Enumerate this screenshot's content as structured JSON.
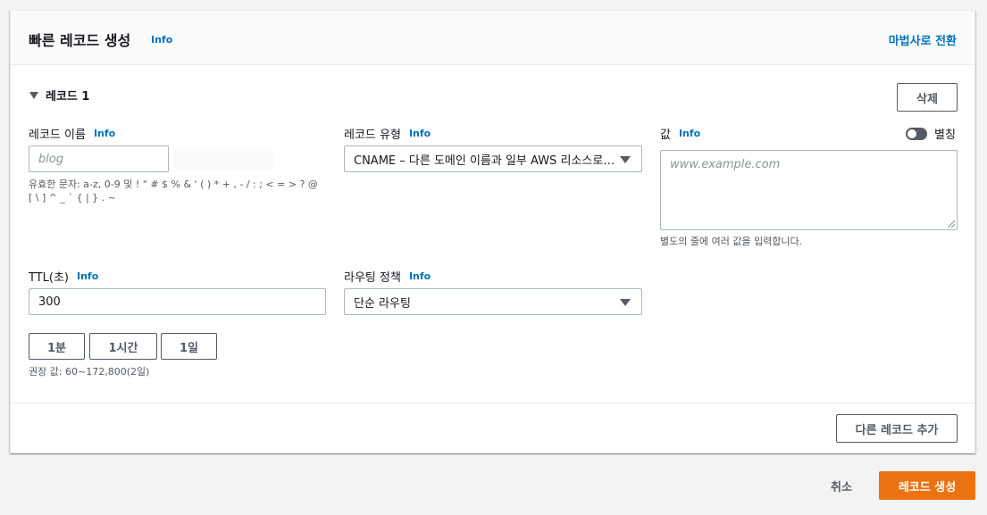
{
  "header": {
    "title": "빠른 레코드 생성",
    "info": "Info",
    "wizard_link": "마법사로 전환"
  },
  "record": {
    "title": "레코드 1",
    "delete_label": "삭제",
    "name": {
      "label": "레코드 이름",
      "info": "Info",
      "placeholder": "blog",
      "hint": "유효한 문자: a-z, 0-9 및 ! \" # $ % & ' ( ) * + , - / : ; < = > ? @ [ \\ ] ^ _ ` { | } . ~"
    },
    "type": {
      "label": "레코드 유형",
      "info": "Info",
      "value": "CNAME – 다른 도메인 이름과 일부 AWS 리소스로…"
    },
    "value": {
      "label": "값",
      "info": "Info",
      "alias_label": "별칭",
      "alias_enabled": false,
      "placeholder": "www.example.com",
      "hint": "별도의 줄에 여러 값을 입력합니다."
    },
    "ttl": {
      "label": "TTL(초)",
      "info": "Info",
      "value": "300",
      "presets": [
        "1분",
        "1시간",
        "1일"
      ],
      "hint": "권장 값: 60~172,800(2일)"
    },
    "routing": {
      "label": "라우팅 정책",
      "info": "Info",
      "value": "단순 라우팅"
    }
  },
  "footer": {
    "add_record": "다른 레코드 추가",
    "cancel": "취소",
    "create": "레코드 생성"
  },
  "colors": {
    "primary": "#ec7211",
    "link": "#0073bb"
  }
}
